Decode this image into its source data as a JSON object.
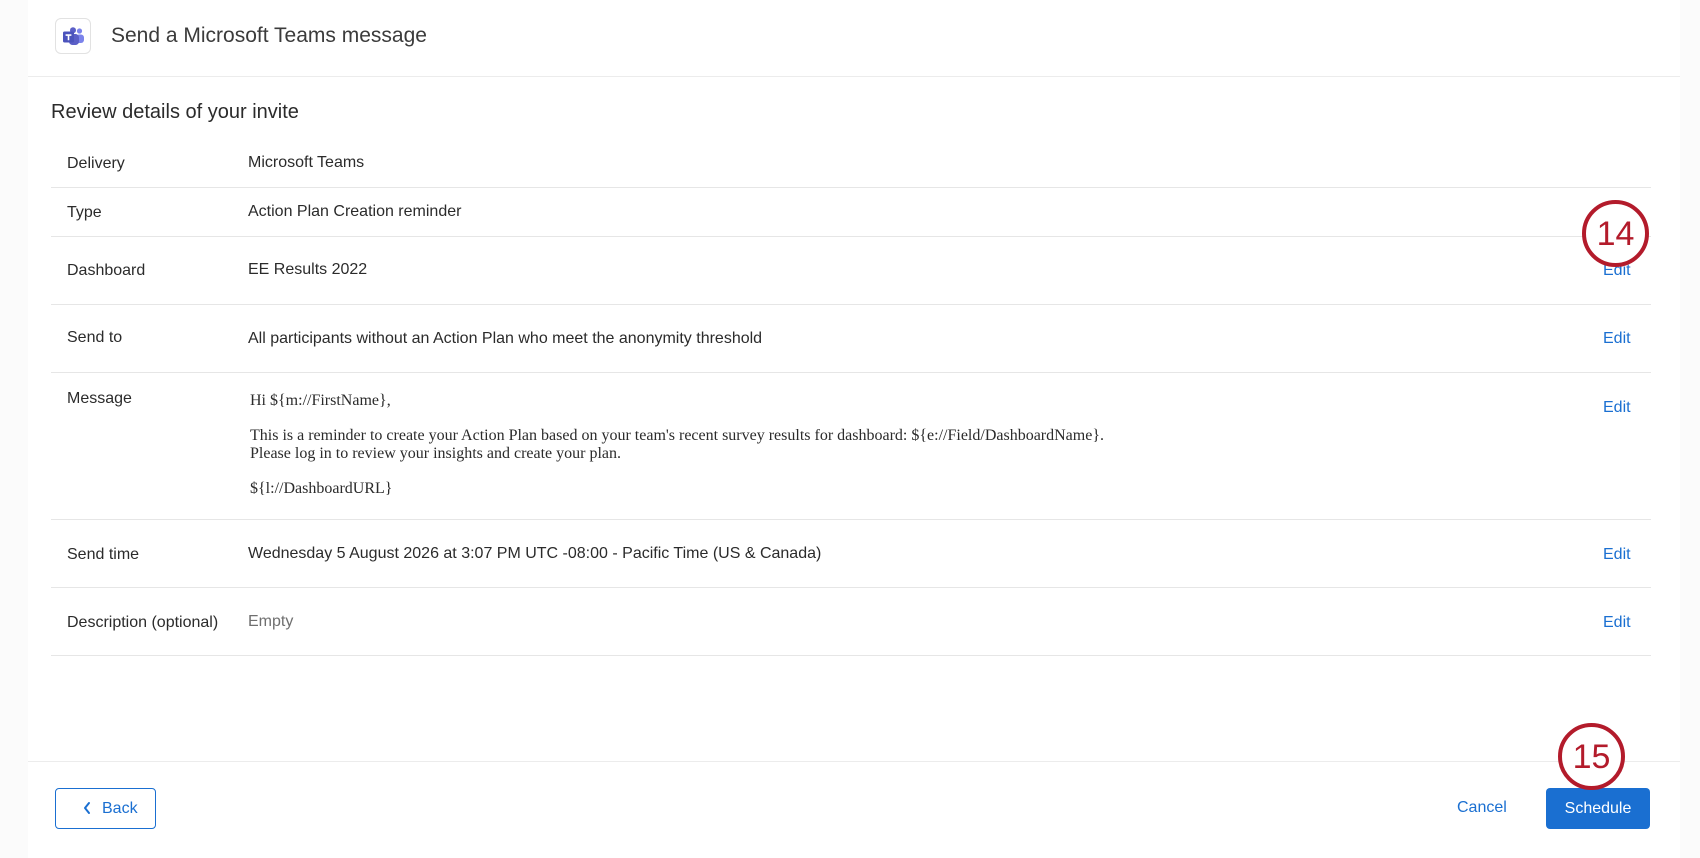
{
  "header": {
    "logo_icon": "microsoft-teams-icon",
    "title": "Send a Microsoft Teams message"
  },
  "review": {
    "title": "Review details of your invite",
    "rows": [
      {
        "label": "Delivery",
        "value": "Microsoft Teams"
      },
      {
        "label": "Type",
        "value": "Action Plan Creation reminder"
      },
      {
        "label": "Dashboard",
        "value": "EE Results 2022",
        "edit": "Edit"
      },
      {
        "label": "Send to",
        "value": "All participants without an Action Plan who meet the anonymity threshold",
        "edit": "Edit"
      },
      {
        "label": "Message",
        "edit": "Edit"
      },
      {
        "label": "Send time",
        "value": "Wednesday 5 August 2026 at 3:07 PM UTC -08:00 - Pacific Time (US & Canada)",
        "edit": "Edit"
      },
      {
        "label": "Description (optional)",
        "value": "Empty",
        "edit": "Edit"
      }
    ],
    "message": {
      "greeting": "Hi ${m://FirstName},",
      "line1": "This is a reminder to create your Action Plan based on your team's recent survey results for dashboard: ${e://Field/DashboardName}.",
      "line2": "Please log in to review your insights and create your plan.",
      "link": "${l://DashboardURL}"
    }
  },
  "footer": {
    "back_label": "Back",
    "cancel_label": "Cancel",
    "schedule_label": "Schedule"
  },
  "callouts": {
    "edit_step": "14",
    "schedule_step": "15"
  },
  "colors": {
    "accent": "#1a6fd1",
    "callout": "#b31b2b",
    "teams_purple": "#5b5fc7"
  }
}
